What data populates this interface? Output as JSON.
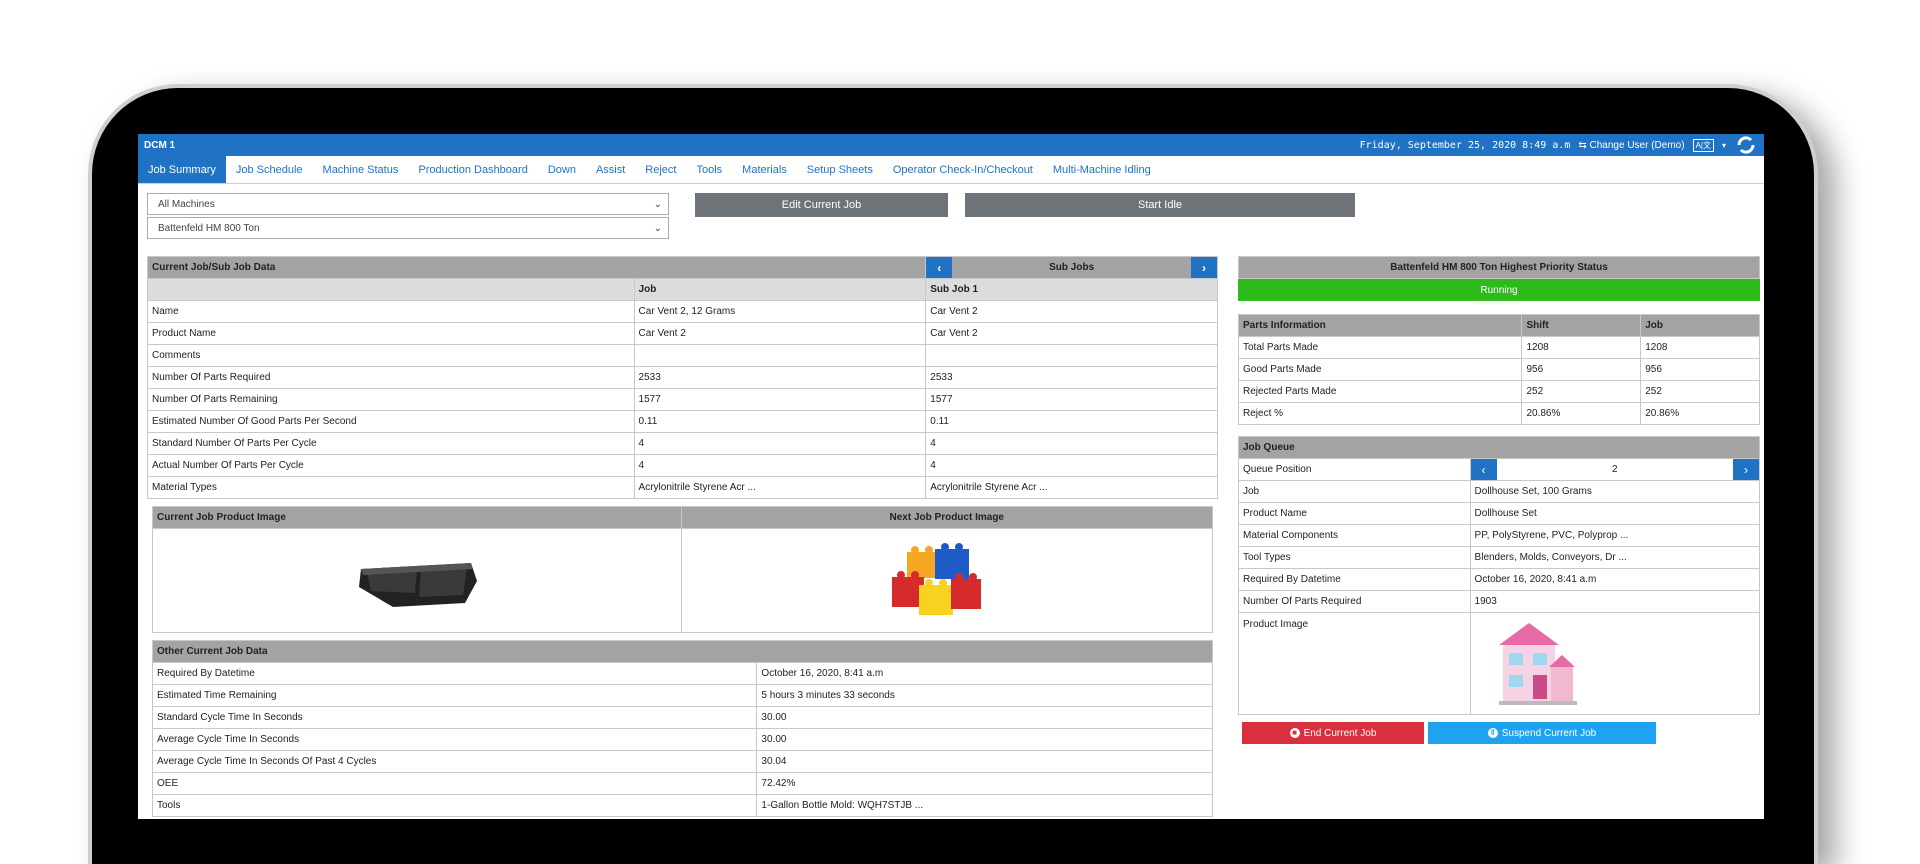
{
  "topbar": {
    "title": "DCM 1",
    "datetime": "Friday, September 25, 2020 8:49 a.m",
    "change_user": "Change User (Demo)"
  },
  "tabs": [
    {
      "label": "Job Summary",
      "active": true
    },
    {
      "label": "Job Schedule"
    },
    {
      "label": "Machine Status"
    },
    {
      "label": "Production Dashboard"
    },
    {
      "label": "Down"
    },
    {
      "label": "Assist"
    },
    {
      "label": "Reject"
    },
    {
      "label": "Tools"
    },
    {
      "label": "Materials"
    },
    {
      "label": "Setup Sheets"
    },
    {
      "label": "Operator Check-In/Checkout"
    },
    {
      "label": "Multi-Machine Idling"
    }
  ],
  "controls": {
    "machines_select": "All Machines",
    "machine_select": "Battenfeld HM 800 Ton",
    "edit_button": "Edit Current Job",
    "idle_button": "Start Idle"
  },
  "current_job": {
    "title": "Current Job/Sub Job Data",
    "sub_jobs_label": "Sub Jobs",
    "col_job": "Job",
    "col_sub": "Sub Job 1",
    "rows": [
      {
        "label": "Name",
        "job": "Car Vent 2, 12 Grams",
        "sub": "Car Vent 2"
      },
      {
        "label": "Product Name",
        "job": "Car Vent 2",
        "sub": "Car Vent 2"
      },
      {
        "label": "Comments",
        "job": "",
        "sub": ""
      },
      {
        "label": "Number Of Parts Required",
        "job": "2533",
        "sub": "2533"
      },
      {
        "label": "Number Of Parts Remaining",
        "job": "1577",
        "sub": "1577"
      },
      {
        "label": "Estimated Number Of Good Parts Per Second",
        "job": "0.11",
        "sub": "0.11"
      },
      {
        "label": "Standard Number Of Parts Per Cycle",
        "job": "4",
        "sub": "4"
      },
      {
        "label": "Actual Number Of Parts Per Cycle",
        "job": "4",
        "sub": "4"
      },
      {
        "label": "Material Types",
        "job": "Acrylonitrile Styrene Acr ...",
        "sub": "Acrylonitrile Styrene Acr ..."
      }
    ]
  },
  "images": {
    "current_label": "Current Job Product Image",
    "next_label": "Next Job Product Image"
  },
  "other_job": {
    "title": "Other Current Job Data",
    "rows": [
      {
        "label": "Required By Datetime",
        "value": "October 16, 2020, 8:41 a.m"
      },
      {
        "label": "Estimated Time Remaining",
        "value": "5 hours 3 minutes 33 seconds"
      },
      {
        "label": "Standard Cycle Time In Seconds",
        "value": "30.00"
      },
      {
        "label": "Average Cycle Time In Seconds",
        "value": "30.00"
      },
      {
        "label": "Average Cycle Time In Seconds Of Past 4 Cycles",
        "value": "30.04"
      },
      {
        "label": "OEE",
        "value": "72.42%"
      },
      {
        "label": "Tools",
        "value": "1-Gallon Bottle Mold: WQH7STJB ..."
      }
    ]
  },
  "priority": {
    "title": "Battenfeld HM 800 Ton Highest Priority Status",
    "status": "Running"
  },
  "parts": {
    "title": "Parts Information",
    "col_shift": "Shift",
    "col_job": "Job",
    "rows": [
      {
        "label": "Total Parts Made",
        "shift": "1208",
        "job": "1208"
      },
      {
        "label": "Good Parts Made",
        "shift": "956",
        "job": "956"
      },
      {
        "label": "Rejected Parts Made",
        "shift": "252",
        "job": "252"
      },
      {
        "label": "Reject %",
        "shift": "20.86%",
        "job": "20.86%"
      }
    ]
  },
  "queue": {
    "title": "Job Queue",
    "position_label": "Queue Position",
    "position_value": "2",
    "rows": [
      {
        "label": "Job",
        "value": "Dollhouse Set, 100 Grams"
      },
      {
        "label": "Product Name",
        "value": "Dollhouse Set"
      },
      {
        "label": "Material Components",
        "value": "PP, PolyStyrene, PVC, Polyprop ..."
      },
      {
        "label": "Tool Types",
        "value": "Blenders, Molds, Conveyors, Dr ..."
      },
      {
        "label": "Required By Datetime",
        "value": "October 16, 2020, 8:41 a.m"
      },
      {
        "label": "Number Of Parts Required",
        "value": "1903"
      }
    ],
    "image_label": "Product Image",
    "end_button": "End Current Job",
    "suspend_button": "Suspend Current Job"
  },
  "colors": {
    "accent": "#1f72c4",
    "running": "#2dbb1b",
    "danger": "#d9303f",
    "info": "#1fa3f0"
  }
}
